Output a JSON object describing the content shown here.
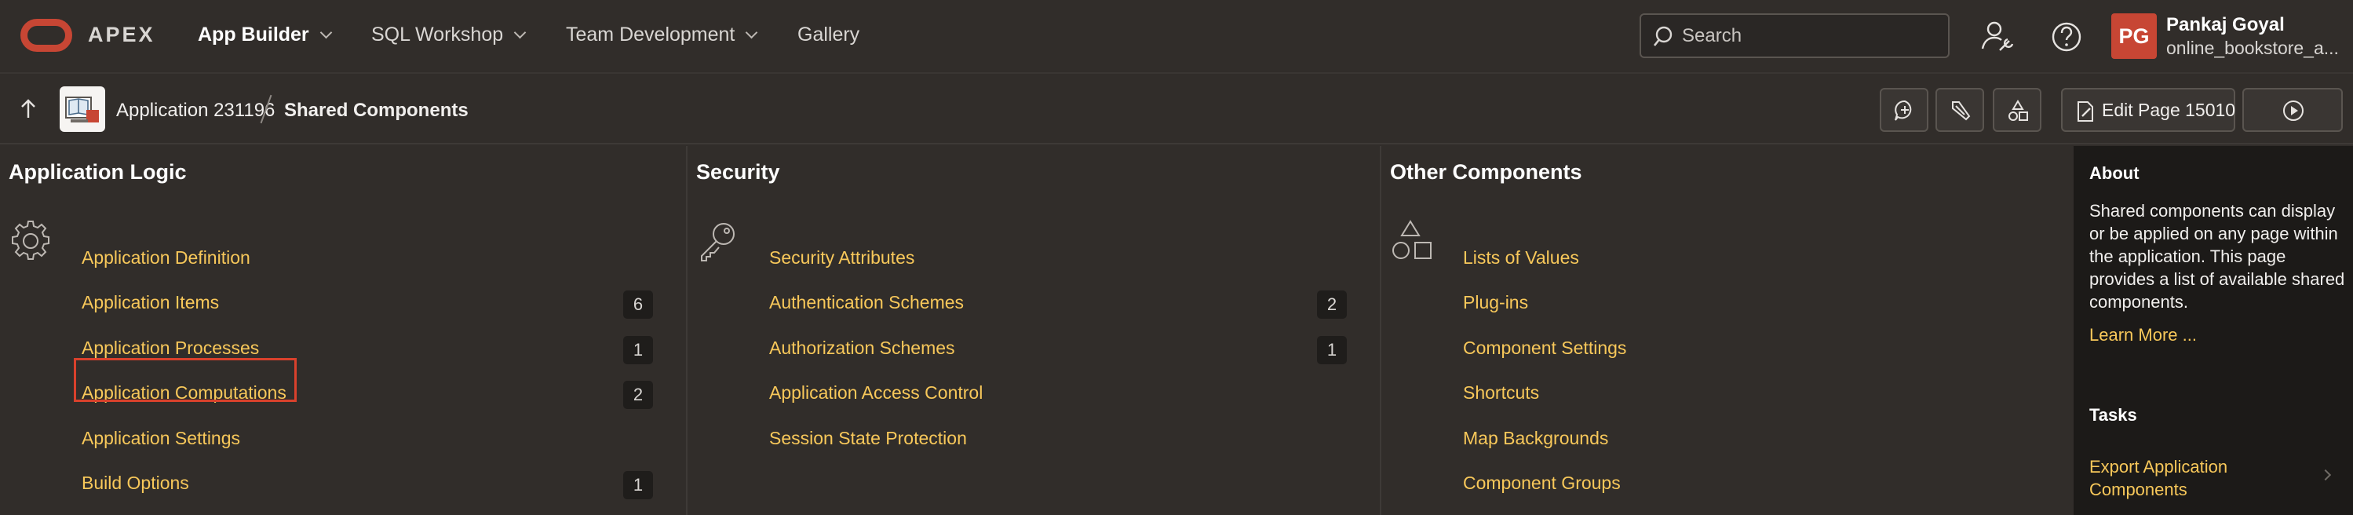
{
  "header": {
    "brand": "APEX",
    "nav": [
      {
        "label": "App Builder"
      },
      {
        "label": "SQL Workshop"
      },
      {
        "label": "Team Development"
      },
      {
        "label": "Gallery"
      }
    ],
    "search_placeholder": "Search",
    "user": {
      "initials": "PG",
      "name": "Pankaj Goyal",
      "workspace": "online_bookstore_a..."
    },
    "icons": [
      "oracle-logo",
      "search-icon",
      "admin-user-icon",
      "help-icon"
    ]
  },
  "subbar": {
    "breadcrumb": [
      "Application 231196",
      "Shared Components"
    ],
    "edit_page_label": "Edit Page 15010",
    "icons": [
      "up-arrow-icon",
      "app-icon",
      "comment-icon",
      "highlighter-icon",
      "shapes-icon",
      "edit-page-icon",
      "run-icon"
    ]
  },
  "columns": [
    {
      "title": "Application Logic",
      "icon": "gear-icon",
      "links": [
        {
          "label": "Application Definition",
          "count": ""
        },
        {
          "label": "Application Items",
          "count": "6"
        },
        {
          "label": "Application Processes",
          "count": "1"
        },
        {
          "label": "Application Computations",
          "count": "2",
          "highlighted": true
        },
        {
          "label": "Application Settings",
          "count": ""
        },
        {
          "label": "Build Options",
          "count": "1"
        }
      ]
    },
    {
      "title": "Security",
      "icon": "key-icon",
      "links": [
        {
          "label": "Security Attributes",
          "count": ""
        },
        {
          "label": "Authentication Schemes",
          "count": "2"
        },
        {
          "label": "Authorization Schemes",
          "count": "1"
        },
        {
          "label": "Application Access Control",
          "count": ""
        },
        {
          "label": "Session State Protection",
          "count": ""
        }
      ]
    },
    {
      "title": "Other Components",
      "icon": "shapes-icon",
      "links": [
        {
          "label": "Lists of Values",
          "count": ""
        },
        {
          "label": "Plug-ins",
          "count": ""
        },
        {
          "label": "Component Settings",
          "count": ""
        },
        {
          "label": "Shortcuts",
          "count": ""
        },
        {
          "label": "Map Backgrounds",
          "count": ""
        },
        {
          "label": "Component Groups",
          "count": ""
        }
      ]
    }
  ],
  "about": {
    "title": "About",
    "text": "Shared components can display or be applied on any page within the application. This page provides a list of available shared components.",
    "learn_more": "Learn More ...",
    "tasks_title": "Tasks",
    "tasks": [
      {
        "label": "Export Application Components"
      }
    ]
  },
  "colors": {
    "background": "#312d2a",
    "link": "#f8c85a",
    "accent": "#c74634",
    "highlight_border": "#d9412c",
    "panel": "#1c1a18"
  }
}
